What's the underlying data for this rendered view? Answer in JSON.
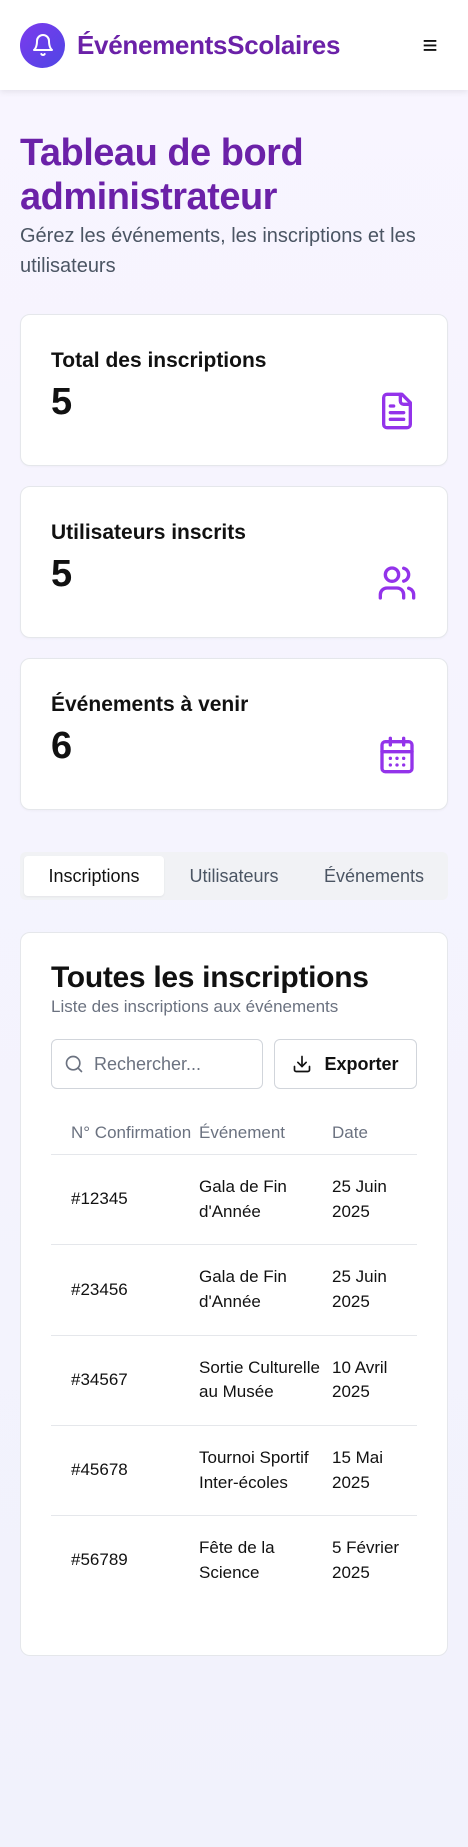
{
  "header": {
    "brand": "ÉvénementsScolaires",
    "logo_icon": "bell-icon",
    "menu_icon": "hamburger-menu-icon",
    "menu_glyph": "≡",
    "brand_color": "#6b21a8",
    "accent_gradient": [
      "#7c3aed",
      "#4f46e5"
    ]
  },
  "page": {
    "title": "Tableau de bord administrateur",
    "subtitle": "Gérez les événements, les inscriptions et les utilisateurs"
  },
  "stats": [
    {
      "label": "Total des inscriptions",
      "value": "5",
      "icon": "document-icon"
    },
    {
      "label": "Utilisateurs inscrits",
      "value": "5",
      "icon": "users-icon"
    },
    {
      "label": "Événements à venir",
      "value": "6",
      "icon": "calendar-icon"
    }
  ],
  "tabs": [
    {
      "label": "Inscriptions",
      "active": true
    },
    {
      "label": "Utilisateurs",
      "active": false
    },
    {
      "label": "Événements",
      "active": false
    }
  ],
  "panel": {
    "title": "Toutes les inscriptions",
    "subtitle": "Liste des inscriptions aux événements",
    "search_placeholder": "Rechercher...",
    "search_icon": "search-icon",
    "export_label": "Exporter",
    "export_icon": "download-icon"
  },
  "table": {
    "columns": [
      "N° Confirmation",
      "Événement",
      "Date"
    ],
    "rows": [
      {
        "confirmation": "#12345",
        "event": "Gala de Fin d'Année",
        "date": "25 Juin 2025"
      },
      {
        "confirmation": "#23456",
        "event": "Gala de Fin d'Année",
        "date": "25 Juin 2025"
      },
      {
        "confirmation": "#34567",
        "event": "Sortie Culturelle au Musée",
        "date": "10 Avril 2025"
      },
      {
        "confirmation": "#45678",
        "event": "Tournoi Sportif Inter-écoles",
        "date": "15 Mai 2025"
      },
      {
        "confirmation": "#56789",
        "event": "Fête de la Science",
        "date": "5 Février 2025"
      }
    ]
  },
  "colors": {
    "icon_purple": "#9333ea",
    "title_purple": "#6b21a8"
  }
}
